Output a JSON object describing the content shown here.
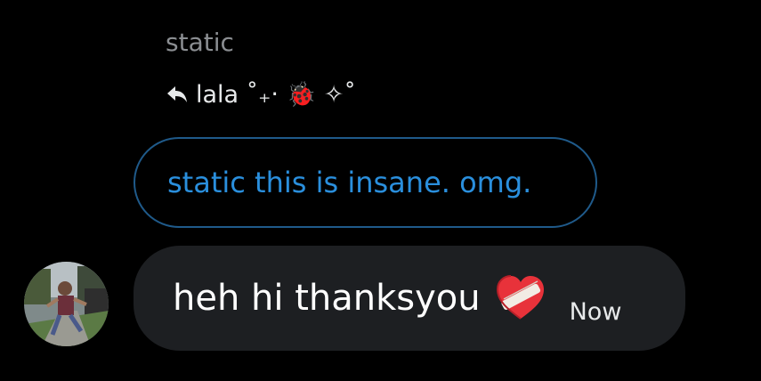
{
  "conversation": {
    "sender_name": "static",
    "reply": {
      "icon": "reply-arrow-icon",
      "name": "lala ˚₊‧ 🐞 ✧˚"
    },
    "quoted_message": "static this is insane. omg.",
    "message": {
      "text": "heh hi thanksyou",
      "emoji_icon": "mending-heart-icon",
      "timestamp": "Now"
    },
    "avatar_icon": "user-avatar-photo"
  },
  "colors": {
    "background": "#000000",
    "quoted_text": "#2a8fdd",
    "quoted_border": "#1f5a8a",
    "bubble": "#1d1f22",
    "muted_text": "#8b8e92"
  }
}
